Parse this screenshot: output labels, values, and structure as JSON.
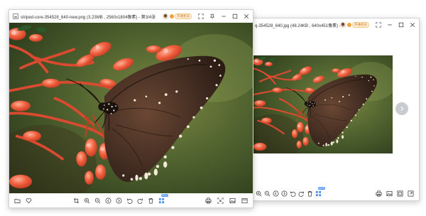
{
  "window_main": {
    "title": "striped-core-354528_640-new.png (3.23MB , 2560x1804像素) - 第3/4张",
    "vip_label": "开通会员"
  },
  "window_second": {
    "title": "q-354528_640.jpg (48.24KB , 640x451像素) - ...",
    "vip_label": "开通会员"
  },
  "toolbar": {
    "new_badge": "NEW"
  },
  "colors": {
    "brand_vip": "#f2a23a",
    "new_badge": "#4b8ff5",
    "photo_background": "#4a5a2c",
    "flower": "#e8553e"
  },
  "icons": [
    "folder-icon",
    "heart-icon",
    "crop-icon",
    "zoom-in-icon",
    "zoom-out-icon",
    "previous-icon",
    "next-icon",
    "rotate-left-icon",
    "rotate-right-icon",
    "delete-icon",
    "grid-icon",
    "print-icon",
    "fit-screen-icon",
    "image-icon",
    "fullscreen-icon"
  ]
}
